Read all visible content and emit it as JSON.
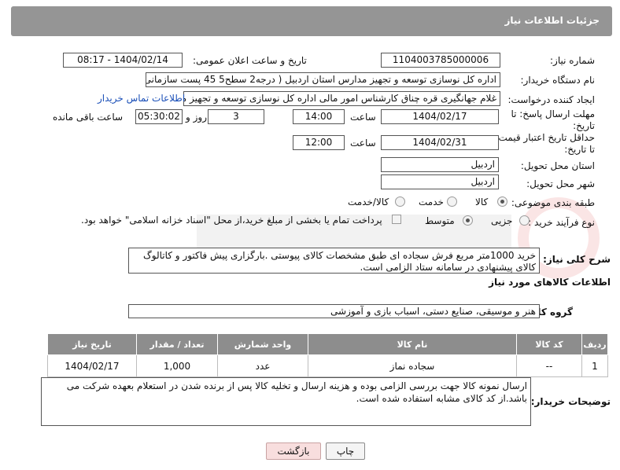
{
  "header": {
    "title": "جزئیات اطلاعات نیاز"
  },
  "fields": {
    "need_number_label": "شماره نیاز:",
    "need_number": "1104003785000006",
    "announce_label": "تاریخ و ساعت اعلان عمومی:",
    "announce_value": "1404/02/14 - 08:17",
    "buyer_org_label": "نام دستگاه خریدار:",
    "buyer_org": "اداره کل نوسازی   توسعه و تجهیز مدارس استان اردبیل ( درجه2  سطح5  45 پست سازمانی)",
    "creator_label": "ایجاد کننده درخواست:",
    "creator": "غلام جهانگیری قره چناق کارشناس امور مالی اداره کل نوسازی   توسعه و تجهیز مدارس",
    "contact_link": "اطلاعات تماس خریدار",
    "reply_deadline_label": "مهلت ارسال پاسخ: تا تاریخ:",
    "reply_date": "1404/02/17",
    "time_label": "ساعت",
    "reply_time": "14:00",
    "days_value": "3",
    "days_label": "روز و",
    "remaining_time": "05:30:02",
    "remaining_label": "ساعت باقی مانده",
    "price_deadline_label": "حداقل تاریخ اعتبار قیمت: تا تاریخ:",
    "price_date": "1404/02/31",
    "price_time": "12:00",
    "province_label": "استان محل تحویل:",
    "province": "اردبیل",
    "city_label": "شهر محل تحویل:",
    "city": "اردبیل",
    "category_label": "طبقه بندی موضوعی:",
    "category_options": [
      "کالا",
      "خدمت",
      "کالا/خدمت"
    ],
    "process_label": "نوع فرآیند خرید :",
    "process_options": [
      "جزیی",
      "متوسط"
    ],
    "payment_note": "پرداخت تمام یا بخشی از مبلغ خرید،از محل \"اسناد خزانه اسلامی\" خواهد بود."
  },
  "description": {
    "label": "شرح کلی نیاز:",
    "text": "خرید 1000متر مربع فرش سجاده ای طبق مشخصات کالای پیوستی .بارگزاری پیش فاکتور و کاتالوگ کالای پیشنهادی در سامانه ستاد الزامی است."
  },
  "goods": {
    "section_title": "اطلاعات کالاهای مورد نیاز",
    "group_label": "گروه کالا:",
    "group_value": "هنر و موسیقی، صنایع دستی، اسباب بازی و آموزشی",
    "columns": [
      "ردیف",
      "کد کالا",
      "نام کالا",
      "واحد شمارش",
      "تعداد / مقدار",
      "تاریخ نیاز"
    ],
    "rows": [
      [
        "1",
        "--",
        "سجاده نماز",
        "عدد",
        "1,000",
        "1404/02/17"
      ]
    ]
  },
  "buyer_notes": {
    "label": "توضیحات خریدار:",
    "text": "ارسال نمونه کالا جهت بررسی الزامی بوده و هزینه ارسال و تخلیه کالا پس از برنده شدن در استعلام بعهده شرکت می باشد.از کد کالای مشابه استفاده شده است."
  },
  "buttons": {
    "print": "چاپ",
    "back": "بازگشت"
  },
  "colors": {
    "header_bg": "#959595",
    "table_header_bg": "#8d8d8d",
    "link": "#1a4fb8",
    "back_button_bg": "#f8dede"
  }
}
